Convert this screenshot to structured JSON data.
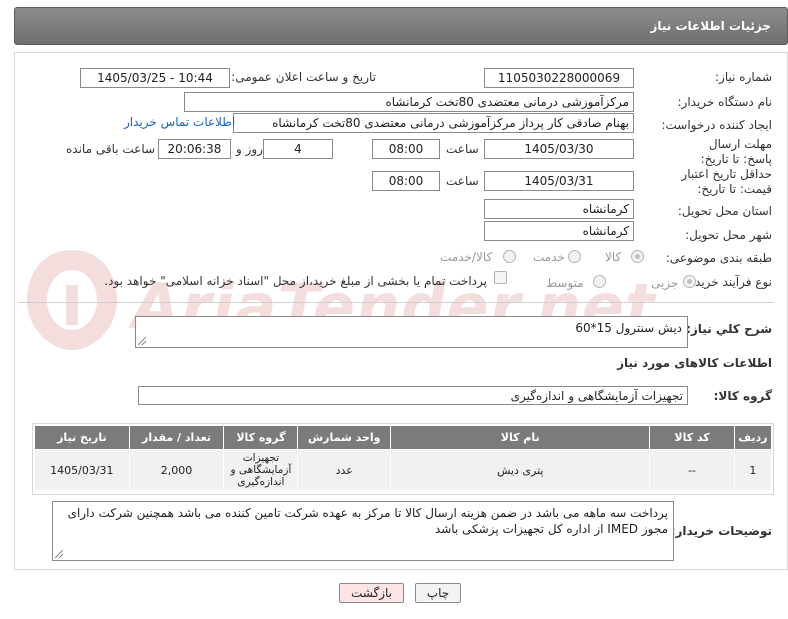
{
  "header": {
    "title": "جزئیات اطلاعات نیاز"
  },
  "fields": {
    "need_number_label": "شماره نیاز:",
    "need_number": "1105030228000069",
    "announce_label": "تاریخ و ساعت اعلان عمومی:",
    "announce_value": "1405/03/25 - 10:44",
    "buyer_org_label": "نام دستگاه خریدار:",
    "buyer_org": "مرکزآموزشی درمانی معتضدی 80تخت کرمانشاه",
    "creator_label": "ایجاد کننده درخواست:",
    "creator": "بهنام صادقی کار پرداز مرکزآموزشی درمانی معتضدی 80تخت کرمانشاه",
    "contact_link": "اطلاعات تماس خریدار",
    "deadline_label": "مهلت ارسال پاسخ: تا تاریخ:",
    "deadline_date": "1405/03/30",
    "time_label": "ساعت",
    "deadline_time": "08:00",
    "days_value": "4",
    "days_label": "روز و",
    "remaining_time": "20:06:38",
    "remaining_label": "ساعت باقی مانده",
    "price_valid_label": "حداقل تاریخ اعتبار قیمت: تا تاریخ:",
    "price_valid_date": "1405/03/31",
    "price_valid_time": "08:00",
    "province_label": "استان محل تحویل:",
    "province": "کرمانشاه",
    "city_label": "شهر محل تحویل:",
    "city": "کرمانشاه",
    "category_label": "طبقه بندی موضوعی:",
    "category_options": [
      "کالا",
      "خدمت",
      "کالا/خدمت"
    ],
    "process_label": "نوع فرآیند خرید :",
    "process_options": [
      "جزیی",
      "متوسط"
    ],
    "payment_note": "پرداخت تمام یا بخشی از مبلغ خرید،از محل \"اسناد خزانه اسلامی\" خواهد بود."
  },
  "summary": {
    "label": "شرح کلي نياز:",
    "value": "دیش سنترول 15*60"
  },
  "items_section": {
    "title": "اطلاعات کالاهای مورد نیاز",
    "group_label": "گروه کالا:",
    "group_value": "تجهیزات آزمایشگاهی و اندازه‌گیری"
  },
  "table": {
    "headers": [
      "ردیف",
      "کد کالا",
      "نام کالا",
      "واحد شمارش",
      "گروه کالا",
      "تعداد / مقدار",
      "تاریخ نیاز"
    ],
    "rows": [
      [
        "1",
        "--",
        "پتری دیش",
        "عدد",
        "تجهیزات آزمایشگاهی و اندازه‌گیری",
        "2,000",
        "1405/03/31"
      ]
    ]
  },
  "buyer_notes": {
    "label": "توضیحات خریدار:",
    "value": "پرداخت سه ماهه می باشد در ضمن هزینه ارسال کالا تا مرکز به عهده شرکت تامین کننده می باشد همچنین شرکت دارای مجوز IMED از اداره کل تجهیزات پزشکی باشد"
  },
  "buttons": {
    "print": "چاپ",
    "back": "بازگشت"
  },
  "watermark": "AriaTender.net"
}
